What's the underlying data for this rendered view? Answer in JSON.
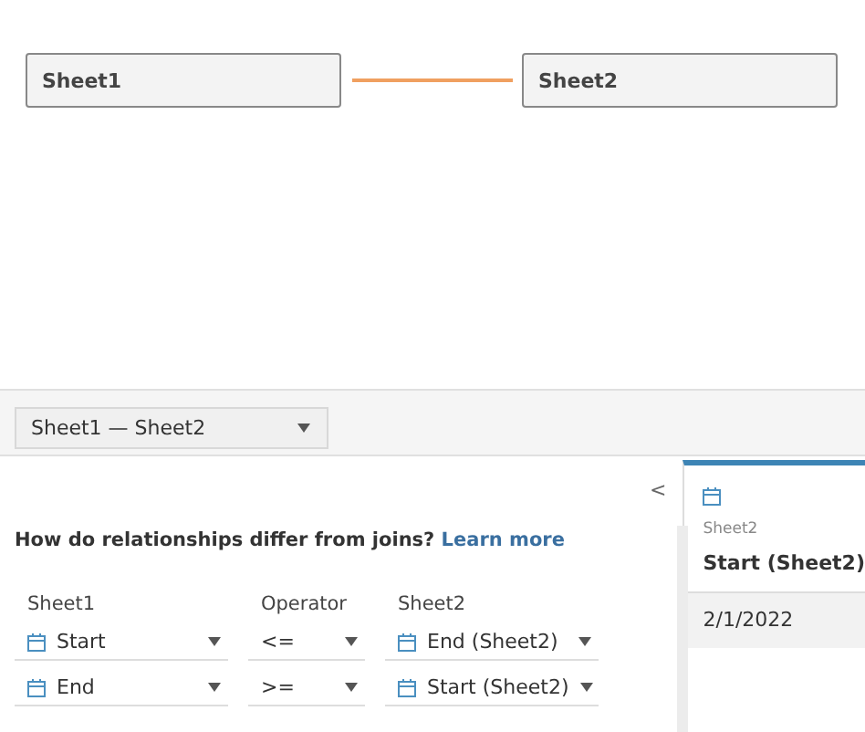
{
  "canvas": {
    "nodes": [
      {
        "label": "Sheet1"
      },
      {
        "label": "Sheet2"
      }
    ]
  },
  "relationship_select": {
    "value": "Sheet1 — Sheet2"
  },
  "collapse_button": "<",
  "help": {
    "text": "How do relationships differ from joins?",
    "link": "Learn more"
  },
  "columns": [
    "Sheet1",
    "Operator",
    "Sheet2"
  ],
  "clauses": [
    {
      "left": "Start",
      "operator": "<=",
      "right": "End (Sheet2)"
    },
    {
      "left": "End",
      "operator": ">=",
      "right": "Start (Sheet2)"
    }
  ],
  "preview": {
    "source": "Sheet2",
    "field": "Start (Sheet2)",
    "values": [
      "2/1/2022"
    ]
  }
}
